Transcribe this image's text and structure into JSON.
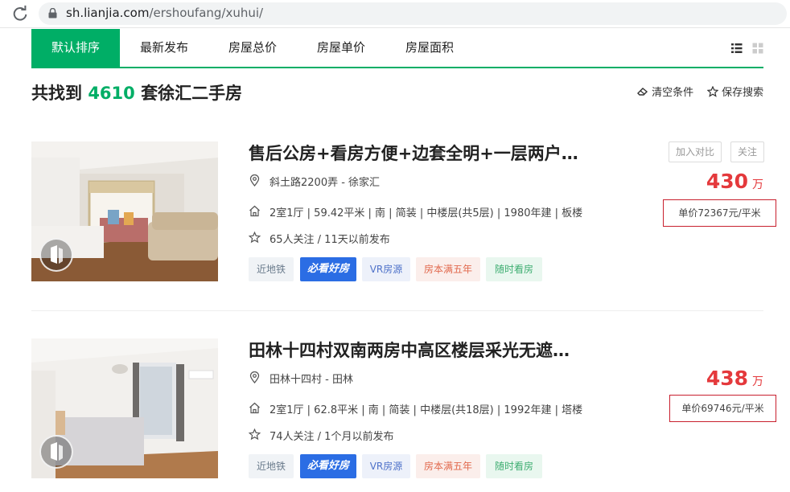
{
  "browser": {
    "url_domain": "sh.lianjia.com",
    "url_path": "/ershoufang/xuhui/",
    "reload_icon": "reload-icon",
    "lock_icon": "lock-icon"
  },
  "sort_tabs": [
    {
      "label": "默认排序",
      "active": true
    },
    {
      "label": "最新发布",
      "active": false
    },
    {
      "label": "房屋总价",
      "active": false
    },
    {
      "label": "房屋单价",
      "active": false
    },
    {
      "label": "房屋面积",
      "active": false
    }
  ],
  "view_icons": [
    "list-view-icon",
    "grid-view-icon"
  ],
  "result": {
    "prefix": "共找到",
    "count": "4610",
    "suffix": "套徐汇二手房"
  },
  "actions": {
    "clear_label": "清空条件",
    "save_label": "保存搜索"
  },
  "listings": [
    {
      "title": "售后公房+看房方便+边套全明+一层两户…",
      "location": "斜土路2200弄 - 徐家汇",
      "house_info": "2室1厅 | 59.42平米 | 南 | 简装 | 中楼层(共5层) | 1980年建 | 板楼",
      "follow_info": "65人关注 / 11天以前发布",
      "tags": [
        "近地铁",
        "必看好房",
        "VR房源",
        "房本满五年",
        "随时看房"
      ],
      "compare_label": "加入对比",
      "follow_label": "关注",
      "total_price": "430",
      "price_unit": "万",
      "unit_price": "单价72367元/平米"
    },
    {
      "title": "田林十四村双南两房中高区楼层采光无遮…",
      "location": "田林十四村 - 田林",
      "house_info": "2室1厅 | 62.8平米 | 南 | 简装 | 中楼层(共18层) | 1992年建 | 塔楼",
      "follow_info": "74人关注 / 1个月以前发布",
      "tags": [
        "近地铁",
        "必看好房",
        "VR房源",
        "房本满五年",
        "随时看房"
      ],
      "total_price": "438",
      "price_unit": "万",
      "unit_price": "单价69746元/平米"
    }
  ],
  "colors": {
    "brand_green": "#00ae66",
    "price_red": "#e4393c",
    "unit_price_border": "#c8202e",
    "bikan_blue": "#2b6de4"
  }
}
